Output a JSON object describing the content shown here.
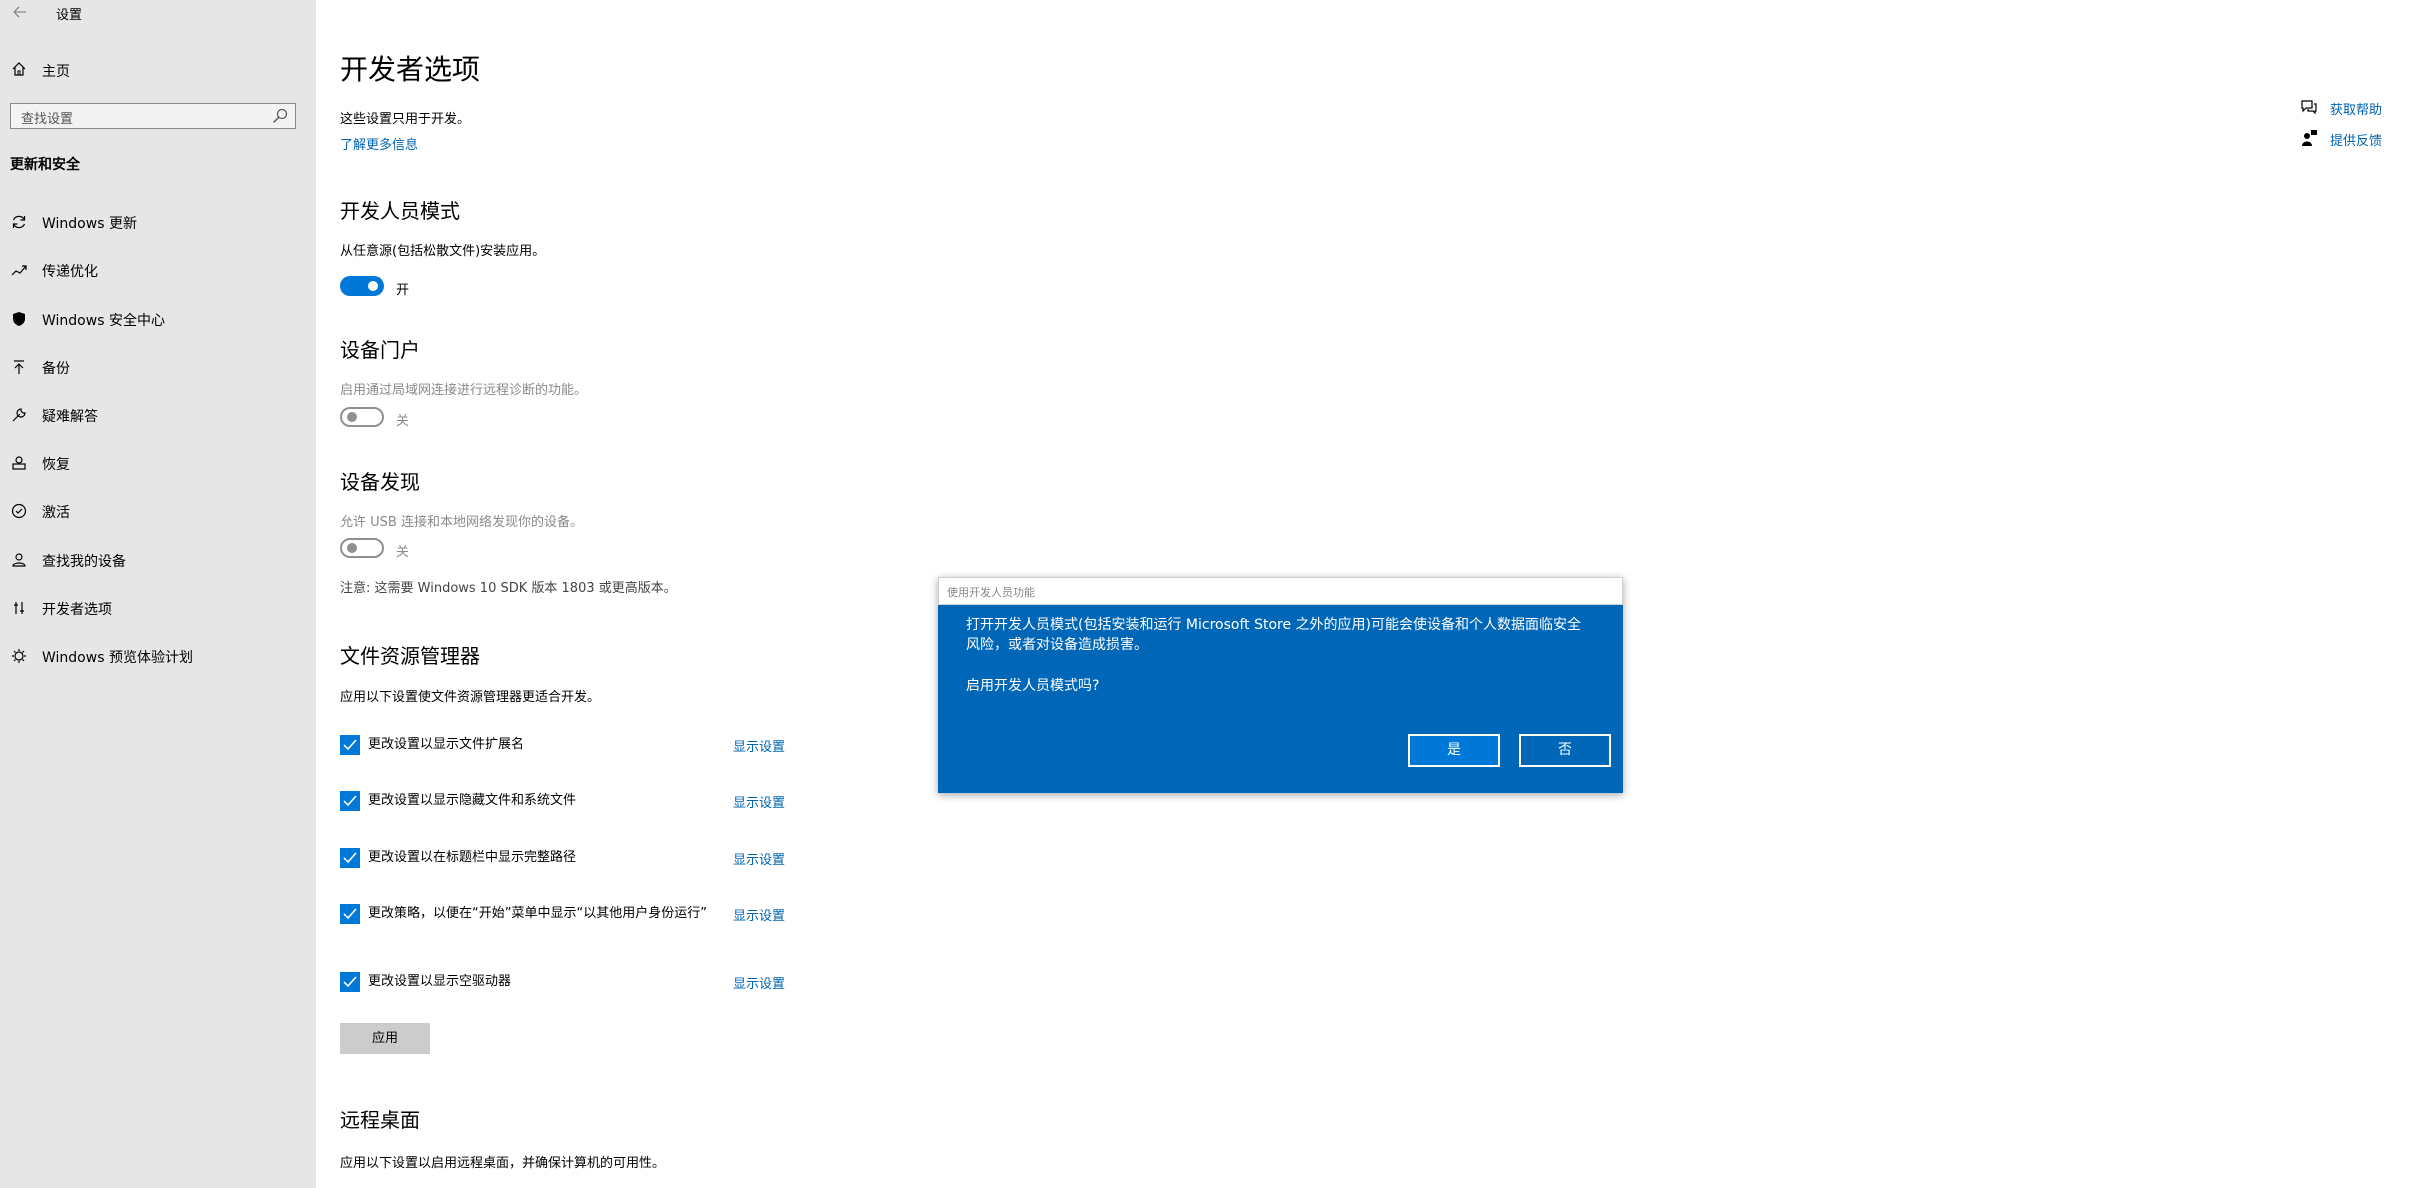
{
  "window": {
    "title": "设置"
  },
  "sidebar": {
    "home_label": "主页",
    "search_placeholder": "查找设置",
    "section_title": "更新和安全",
    "items": [
      {
        "label": "Windows 更新",
        "icon": "refresh-icon"
      },
      {
        "label": "传递优化",
        "icon": "delivery-optimization-icon"
      },
      {
        "label": "Windows 安全中心",
        "icon": "shield-icon"
      },
      {
        "label": "备份",
        "icon": "backup-icon"
      },
      {
        "label": "疑难解答",
        "icon": "wrench-icon"
      },
      {
        "label": "恢复",
        "icon": "recovery-icon"
      },
      {
        "label": "激活",
        "icon": "check-circle-icon"
      },
      {
        "label": "查找我的设备",
        "icon": "find-device-icon"
      },
      {
        "label": "开发者选项",
        "icon": "developer-icon"
      },
      {
        "label": "Windows 预览体验计划",
        "icon": "insider-icon"
      }
    ]
  },
  "main": {
    "title": "开发者选项",
    "subtitle": "这些设置只用于开发。",
    "learn_more": "了解更多信息",
    "dev_mode": {
      "heading": "开发人员模式",
      "desc": "从任意源(包括松散文件)安装应用。",
      "toggle_state": "on",
      "toggle_label": "开"
    },
    "device_portal": {
      "heading": "设备门户",
      "desc": "启用通过局域网连接进行远程诊断的功能。",
      "toggle_state": "off",
      "toggle_label": "关"
    },
    "device_discovery": {
      "heading": "设备发现",
      "desc": "允许 USB 连接和本地网络发现你的设备。",
      "toggle_state": "off",
      "toggle_label": "关",
      "note": "注意: 这需要 Windows 10 SDK 版本 1803 或更高版本。"
    },
    "file_explorer": {
      "heading": "文件资源管理器",
      "desc": "应用以下设置使文件资源管理器更适合开发。",
      "options": [
        {
          "label": "更改设置以显示文件扩展名",
          "checked": true,
          "link": "显示设置"
        },
        {
          "label": "更改设置以显示隐藏文件和系统文件",
          "checked": true,
          "link": "显示设置"
        },
        {
          "label": "更改设置以在标题栏中显示完整路径",
          "checked": true,
          "link": "显示设置"
        },
        {
          "label": "更改策略，以便在“开始”菜单中显示“以其他用户身份运行”",
          "checked": true,
          "link": "显示设置"
        },
        {
          "label": "更改设置以显示空驱动器",
          "checked": true,
          "link": "显示设置"
        }
      ],
      "apply_label": "应用"
    },
    "remote_desktop": {
      "heading": "远程桌面",
      "desc": "应用以下设置以启用远程桌面，并确保计算机的可用性。"
    }
  },
  "help": {
    "get_help": "获取帮助",
    "feedback": "提供反馈"
  },
  "dialog": {
    "title": "使用开发人员功能",
    "message": "打开开发人员模式(包括安装和运行 Microsoft Store 之外的应用)可能会使设备和个人数据面临安全风险，或者对设备造成损害。",
    "question": "启用开发人员模式吗?",
    "yes_label": "是",
    "no_label": "否"
  },
  "colors": {
    "accent": "#0078d7",
    "link": "#0063b1",
    "dialog_bg": "#0067b8",
    "sidebar_bg": "#e6e6e6"
  }
}
